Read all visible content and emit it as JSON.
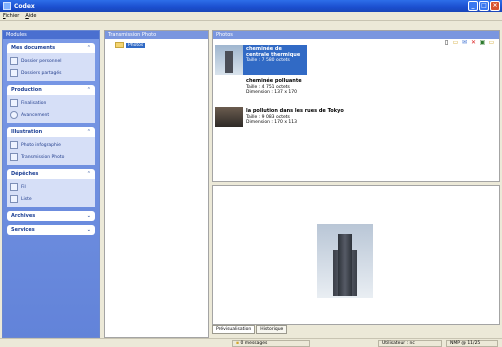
{
  "window": {
    "title": "Codex"
  },
  "menu": [
    "Fichier",
    "Aide"
  ],
  "sidebar": {
    "header": "Modules",
    "groups": [
      {
        "title": "Mes documents",
        "items": [
          "Dossier personnel",
          "Dossiers partagés"
        ]
      },
      {
        "title": "Production",
        "items": [
          "Finalisation",
          "Avancement"
        ]
      },
      {
        "title": "Illustration",
        "items": [
          "Photo infographie",
          "Transmission Photo"
        ]
      },
      {
        "title": "Dépêches",
        "items": [
          "Fil",
          "Liste"
        ]
      },
      {
        "title": "Archives",
        "items": []
      },
      {
        "title": "Services",
        "items": []
      }
    ]
  },
  "tree": {
    "header": "Transmission Photo",
    "root": "Photos"
  },
  "photos": {
    "header": "Photos",
    "items": [
      {
        "title": "cheminée de centrale thermique",
        "meta": "Taille : 7 580 octets"
      },
      {
        "title": "cheminée polluante",
        "meta": "Taille : 4 751 octets",
        "meta2": "Dimension : 137 x 170"
      },
      {
        "title": "la pollution dans les rues de Tokyo",
        "meta": "Taille : 9 083 octets",
        "meta2": "Dimension : 170 x 113"
      }
    ]
  },
  "preview": {
    "tabs": [
      "Prévisualisation",
      "Historique"
    ]
  },
  "status": {
    "messages": "0 messages",
    "user": "Utilisateur : nc",
    "network": "NMP @ 11/25"
  }
}
